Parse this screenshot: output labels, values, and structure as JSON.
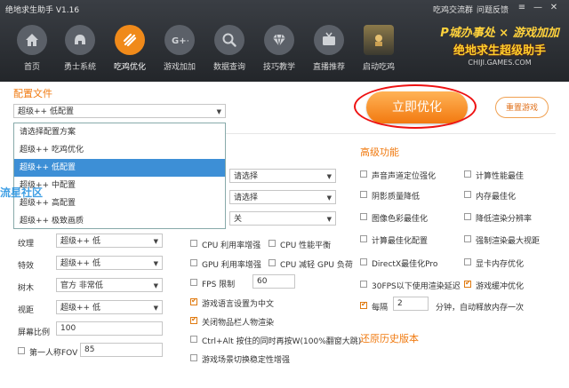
{
  "app": {
    "title": "绝地求生助手 V1.16",
    "links": [
      "吃鸡交流群",
      "问题反馈"
    ],
    "window_controls": [
      "≡",
      "—",
      "✕"
    ]
  },
  "nav": {
    "items": [
      {
        "label": "首页",
        "icon": "home-icon"
      },
      {
        "label": "勇士系统",
        "icon": "helmet-icon"
      },
      {
        "label": "吃鸡优化",
        "icon": "chicken-optimize-icon",
        "active": true
      },
      {
        "label": "游戏加加",
        "icon": "game-plus-icon"
      },
      {
        "label": "数据查询",
        "icon": "search-icon"
      },
      {
        "label": "技巧教学",
        "icon": "diamond-icon"
      },
      {
        "label": "直播推荐",
        "icon": "tv-icon"
      },
      {
        "label": "启动吃鸡",
        "icon": "pubg-logo-icon"
      }
    ]
  },
  "banner": {
    "line1": "P城办事处 × 游戏加加",
    "line2": "绝地求生超级助手",
    "line3": "CHIJI.GAMES.COM"
  },
  "config": {
    "section_title": "配置文件",
    "selected": "超级++ 低配置",
    "dropdown_options": [
      "请选择配置方案",
      "超级++ 吃鸡优化",
      "超级++ 低配置",
      "超级++ 中配置",
      "超级++ 高配置",
      "超级++ 极致画质"
    ],
    "highlighted_index": 2
  },
  "actions": {
    "optimize": "立即优化",
    "reset": "重置游戏"
  },
  "watermark": "流星社区",
  "settings_left": [
    {
      "label": "纹理",
      "value": "超级++ 低"
    },
    {
      "label": "特效",
      "value": "超级++ 低"
    },
    {
      "label": "树木",
      "value": "官方 非常低"
    },
    {
      "label": "视距",
      "value": "超级++ 低"
    }
  ],
  "screen_ratio": {
    "label": "屏幕比例",
    "value": "100"
  },
  "fov": {
    "label": "第一人称FOV",
    "value": "85"
  },
  "mid_selects": [
    "请选择",
    "请选择",
    "关"
  ],
  "mid_checks": {
    "cpu_boost": "CPU 利用率增强",
    "cpu_balance": "CPU 性能平衡",
    "gpu_boost": "GPU 利用率增强",
    "cpu_reduce_gpu": "CPU 减轻 GPU 负荷",
    "fps_limit": "FPS 限制",
    "fps_value": "60",
    "chinese_voice": "游戏语言设置为中文",
    "disable_outline": "关闭物品栏人物渲染",
    "ctrl_alt": "Ctrl+Alt 按住的同时再按W(100%翻窗大跳)",
    "scene_switch": "游戏场景切换稳定性增强"
  },
  "advanced": {
    "section_title": "高级功能",
    "items_left": [
      "声音声道定位强化",
      "阴影质量降低",
      "图像色彩最佳化",
      "计算最佳化配置",
      "DirectX最佳化Pro",
      "30FPS以下使用渲染延迟"
    ],
    "items_right": [
      "计算性能最佳",
      "内存最佳化",
      "降低渲染分辨率",
      "强制渲染最大视距",
      "显卡内存优化",
      "游戏缓冲优化"
    ],
    "every_label": "每隔",
    "every_value": "2",
    "every_suffix": "分钟，自动释放内存一次"
  },
  "restore": {
    "section_title": "还原历史版本"
  }
}
